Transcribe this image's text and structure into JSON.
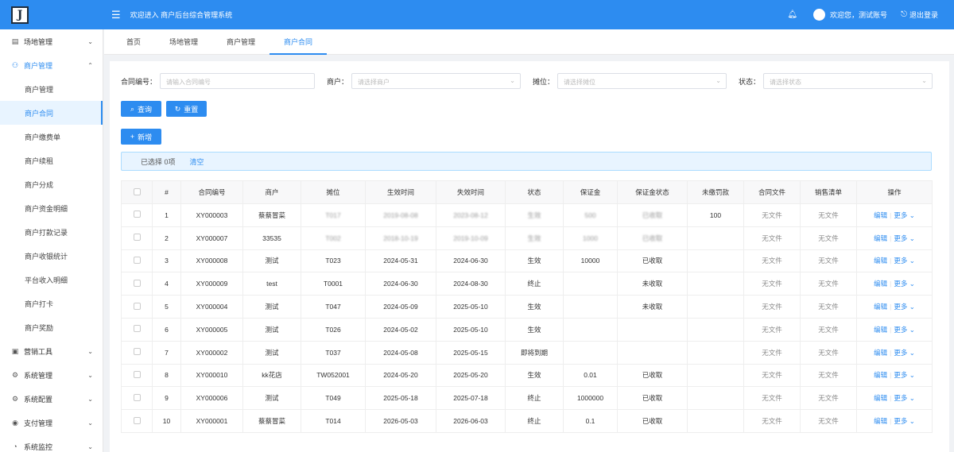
{
  "header": {
    "logo_letter": "J",
    "welcome": "欢迎进入 商户后台综合管理系统",
    "user": "欢迎您，测试账号",
    "logout": "退出登录",
    "accent": "#2d8cf0"
  },
  "sidebar": {
    "groups": [
      {
        "label": "场地管理",
        "icon": "building-icon"
      },
      {
        "label": "商户管理",
        "icon": "people-icon"
      },
      {
        "label": "营销工具",
        "icon": "chart-icon"
      },
      {
        "label": "系统管理",
        "icon": "gear-icon"
      },
      {
        "label": "系统配置",
        "icon": "gear-icon"
      },
      {
        "label": "支付管理",
        "icon": "payment-icon"
      },
      {
        "label": "系统监控",
        "icon": "monitor-icon"
      }
    ],
    "sub_items": [
      "商户管理",
      "商户合同",
      "商户缴费单",
      "商户续租",
      "商户分成",
      "商户资金明细",
      "商户打款记录",
      "商户收银统计",
      "平台收入明细",
      "商户打卡",
      "商户奖励"
    ]
  },
  "tabs": [
    "首页",
    "场地管理",
    "商户管理",
    "商户合同"
  ],
  "filters": {
    "contract_no_label": "合同编号：",
    "contract_no_placeholder": "请输入合同编号",
    "merchant_label": "商户：",
    "merchant_placeholder": "请选择商户",
    "booth_label": "摊位：",
    "booth_placeholder": "请选择摊位",
    "status_label": "状态：",
    "status_placeholder": "请选择状态"
  },
  "buttons": {
    "search": "查询",
    "reset": "重置",
    "add": "新增"
  },
  "selection": {
    "text": "已选择 0项",
    "clear": "清空"
  },
  "table": {
    "columns": [
      "#",
      "合同编号",
      "商户",
      "摊位",
      "生效时间",
      "失效时间",
      "状态",
      "保证金",
      "保证金状态",
      "未缴罚款",
      "合同文件",
      "销售清单",
      "操作"
    ],
    "rows": [
      {
        "idx": "1",
        "no": "XY000003",
        "merchant": "蔡蔡冒菜",
        "booth": "T017",
        "start": "2019-08-08",
        "end": "2023-08-12",
        "status": "生效",
        "deposit": "500",
        "deposit_status": "已收取",
        "fine": "100",
        "file": "无文件",
        "sales": "无文件"
      },
      {
        "idx": "2",
        "no": "XY000007",
        "merchant": "33535",
        "booth": "T002",
        "start": "2018-10-19",
        "end": "2019-10-09",
        "status": "生效",
        "deposit": "1000",
        "deposit_status": "已收取",
        "fine": "",
        "file": "无文件",
        "sales": "无文件"
      },
      {
        "idx": "3",
        "no": "XY000008",
        "merchant": "测试",
        "booth": "T023",
        "start": "2024-05-31",
        "end": "2024-06-30",
        "status": "生效",
        "deposit": "10000",
        "deposit_status": "已收取",
        "fine": "",
        "file": "无文件",
        "sales": "无文件"
      },
      {
        "idx": "4",
        "no": "XY000009",
        "merchant": "test",
        "booth": "T0001",
        "start": "2024-06-30",
        "end": "2024-08-30",
        "status": "终止",
        "deposit": "",
        "deposit_status": "未收取",
        "fine": "",
        "file": "无文件",
        "sales": "无文件"
      },
      {
        "idx": "5",
        "no": "XY000004",
        "merchant": "测试",
        "booth": "T047",
        "start": "2024-05-09",
        "end": "2025-05-10",
        "status": "生效",
        "deposit": "",
        "deposit_status": "未收取",
        "fine": "",
        "file": "无文件",
        "sales": "无文件"
      },
      {
        "idx": "6",
        "no": "XY000005",
        "merchant": "测试",
        "booth": "T026",
        "start": "2024-05-02",
        "end": "2025-05-10",
        "status": "生效",
        "deposit": "",
        "deposit_status": "",
        "fine": "",
        "file": "无文件",
        "sales": "无文件"
      },
      {
        "idx": "7",
        "no": "XY000002",
        "merchant": "测试",
        "booth": "T037",
        "start": "2024-05-08",
        "end": "2025-05-15",
        "status": "即将到期",
        "deposit": "",
        "deposit_status": "",
        "fine": "",
        "file": "无文件",
        "sales": "无文件"
      },
      {
        "idx": "8",
        "no": "XY000010",
        "merchant": "kk花店",
        "booth": "TW052001",
        "start": "2024-05-20",
        "end": "2025-05-20",
        "status": "生效",
        "deposit": "0.01",
        "deposit_status": "已收取",
        "fine": "",
        "file": "无文件",
        "sales": "无文件"
      },
      {
        "idx": "9",
        "no": "XY000006",
        "merchant": "测试",
        "booth": "T049",
        "start": "2025-05-18",
        "end": "2025-07-18",
        "status": "终止",
        "deposit": "1000000",
        "deposit_status": "已收取",
        "fine": "",
        "file": "无文件",
        "sales": "无文件"
      },
      {
        "idx": "10",
        "no": "XY000001",
        "merchant": "蔡蔡冒菜",
        "booth": "T014",
        "start": "2026-05-03",
        "end": "2026-06-03",
        "status": "终止",
        "deposit": "0.1",
        "deposit_status": "已收取",
        "fine": "",
        "file": "无文件",
        "sales": "无文件"
      }
    ],
    "edit_label": "编辑",
    "more_label": "更多"
  }
}
